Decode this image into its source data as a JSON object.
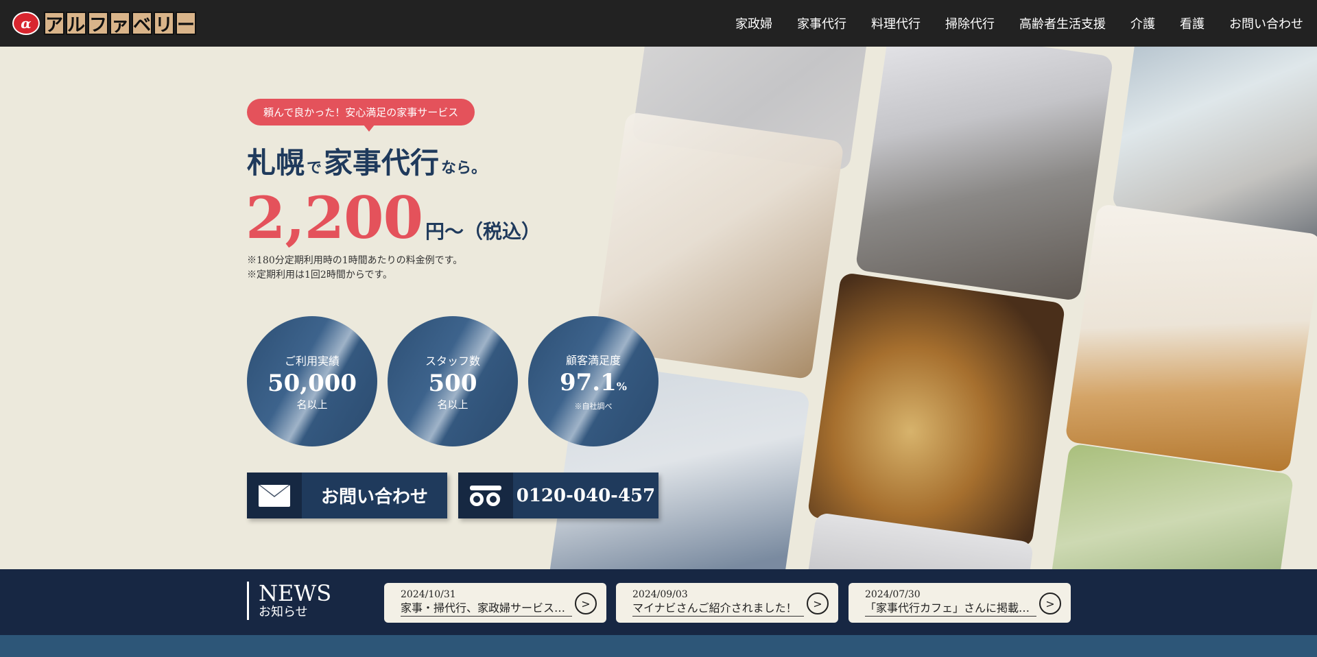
{
  "header": {
    "logo_mark": "α",
    "logo_chars": [
      "ア",
      "ル",
      "フ",
      "ァ",
      "ベ",
      "リ",
      "ー"
    ],
    "nav": [
      "家政婦",
      "家事代行",
      "料理代行",
      "掃除代行",
      "高齢者生活支援",
      "介護",
      "看護",
      "お問い合わせ"
    ]
  },
  "hero": {
    "tagline": "頼んで良かった！安心満足の家事サービス",
    "headline": {
      "part1": "札幌",
      "part2": "で",
      "part3": "家事代行",
      "part4": "なら。"
    },
    "price": "2,200",
    "price_unit": "円〜（税込）",
    "notes": [
      "※180分定期利用時の1時間あたりの料金例です。",
      "※定期利用は1回2時間からです。"
    ],
    "stats": [
      {
        "label": "ご利用実績",
        "value": "50,000",
        "unit": "",
        "sub": "名以上"
      },
      {
        "label": "スタッフ数",
        "value": "500",
        "unit": "",
        "sub": "名以上"
      },
      {
        "label": "顧客満足度",
        "value": "97.1",
        "unit": "%",
        "sub": "※自社調べ"
      }
    ],
    "cta_contact": "お問い合わせ",
    "cta_phone": "0120-040-457"
  },
  "news": {
    "title_en": "NEWS",
    "title_ja": "お知らせ",
    "items": [
      {
        "date": "2024/10/31",
        "text": "家事・掃代行、家政婦サービス…"
      },
      {
        "date": "2024/09/03",
        "text": "マイナビさんご紹介されました！"
      },
      {
        "date": "2024/07/30",
        "text": "「家事代行カフェ」さんに掲載さ…"
      }
    ],
    "arrow": ">"
  },
  "colors": {
    "accent": "#e4525b",
    "navy": "#1f3a5c",
    "news_bg": "#172743",
    "bg": "#ece9dc"
  }
}
